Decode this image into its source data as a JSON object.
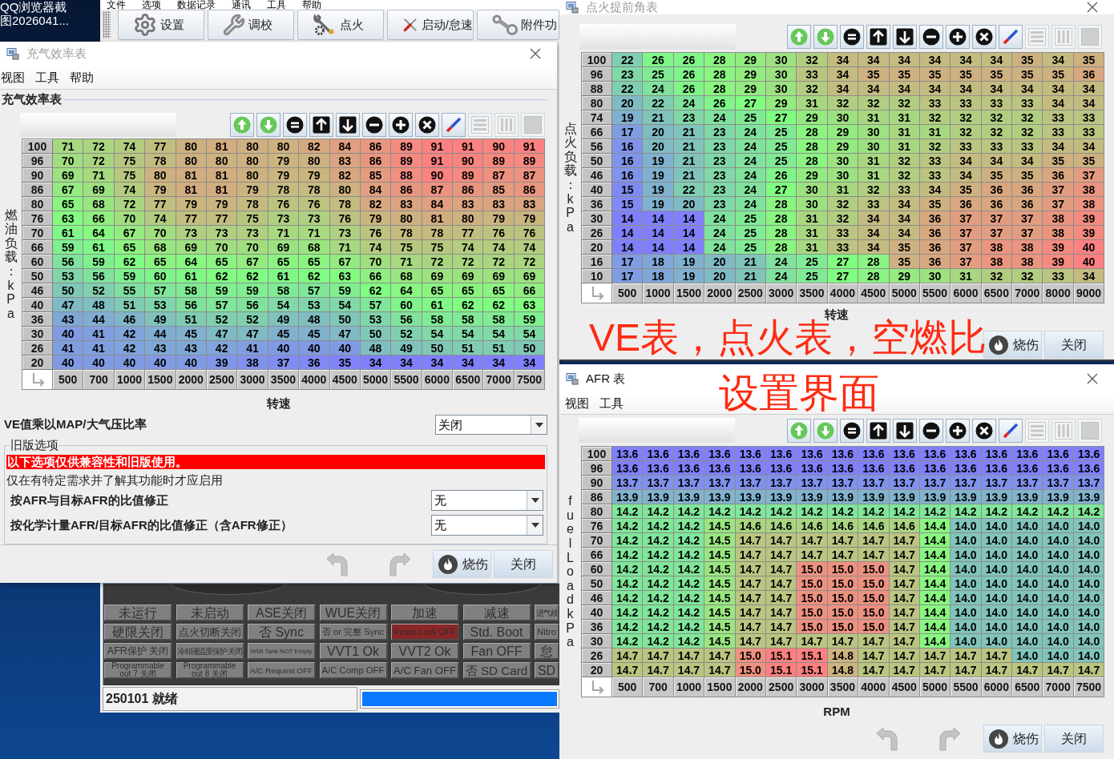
{
  "desktop": {
    "icon_label_lines": [
      "QQ浏览器截",
      "图2026041..."
    ]
  },
  "main_window": {
    "menu": [
      "文件",
      "选项",
      "数据记录",
      "通讯",
      "工具",
      "帮助"
    ],
    "toolbar": [
      "设置",
      "调校",
      "点火",
      "启动/怠速",
      "附件功"
    ],
    "indicators": [
      [
        {
          "label": "未运行",
          "color": "#808080"
        },
        {
          "label": "未启动",
          "color": "#808080"
        },
        {
          "label": "ASE关闭",
          "color": "#808080"
        },
        {
          "label": "WUE关闭",
          "color": "#808080"
        },
        {
          "label": "加速",
          "color": "#808080"
        },
        {
          "label": "减速",
          "color": "#808080"
        },
        {
          "label": "进气歧",
          "color": "#808080"
        }
      ],
      [
        {
          "label": "硬限关闭",
          "color": "#808080"
        },
        {
          "label": "点火切断关闭",
          "color": "#808080"
        },
        {
          "label": "否 Sync",
          "color": "#808080"
        },
        {
          "label": "否 or 完整 Sync",
          "color": "#808080"
        },
        {
          "label": "Reset Lock OFF",
          "color": "#8b2626"
        },
        {
          "label": "Std. Boot",
          "color": "#808080"
        },
        {
          "label": "Nitro",
          "color": "#808080"
        }
      ],
      [
        {
          "label": "AFR保护 关闭",
          "color": "#808080"
        },
        {
          "label": "冷却液温度保护 关闭",
          "color": "#808080"
        },
        {
          "label": "WMI Tank NOT Empty",
          "color": "#808080"
        },
        {
          "label": "VVT1 Ok",
          "color": "#808080"
        },
        {
          "label": "VVT2 Ok",
          "color": "#808080"
        },
        {
          "label": "Fan OFF",
          "color": "#808080"
        },
        {
          "label": "怠",
          "color": "#808080"
        }
      ],
      [
        {
          "label": "Programmable out 7 关闭",
          "color": "#808080"
        },
        {
          "label": "Programmable out 8 关闭",
          "color": "#808080"
        },
        {
          "label": "A/C Request OFF",
          "color": "#808080"
        },
        {
          "label": "A/C Comp OFF",
          "color": "#808080"
        },
        {
          "label": "A/C Fan OFF",
          "color": "#808080"
        },
        {
          "label": "否 SD Card",
          "color": "#808080"
        },
        {
          "label": "SD",
          "color": "#808080"
        }
      ]
    ],
    "status_bar": {
      "text": "250101 就绪",
      "progress": {
        "level": 1
      }
    }
  },
  "ve_window": {
    "title": "充气效率表",
    "active": false,
    "menu": [
      "视图",
      "工具",
      "帮助"
    ],
    "panel_title": "充气效率表",
    "tool_buttons": [
      {
        "disabled": false
      },
      {
        "disabled": false
      },
      {
        "disabled": false
      },
      {
        "disabled": false
      },
      {
        "disabled": false
      },
      {
        "disabled": false
      },
      {
        "disabled": false
      },
      {
        "disabled": false
      },
      {
        "disabled": false
      },
      {
        "disabled": true
      },
      {
        "disabled": true
      },
      {
        "disabled": true
      }
    ],
    "table": {
      "y_axis_label": "燃油负载： kPa",
      "x_axis_label": "转速",
      "y_bins": [
        "100",
        "96",
        "90",
        "86",
        "80",
        "76",
        "70",
        "66",
        "60",
        "50",
        "46",
        "40",
        "36",
        "30",
        "26",
        "20"
      ],
      "x_bins": [
        "500",
        "700",
        "1000",
        "1500",
        "2000",
        "2500",
        "3000",
        "3500",
        "4000",
        "4500",
        "5000",
        "5500",
        "6000",
        "6500",
        "7000",
        "7500"
      ],
      "rows": [
        [
          "71",
          "72",
          "74",
          "77",
          "80",
          "81",
          "80",
          "80",
          "82",
          "84",
          "86",
          "89",
          "91",
          "91",
          "90",
          "91"
        ],
        [
          "70",
          "72",
          "75",
          "78",
          "80",
          "80",
          "80",
          "79",
          "80",
          "83",
          "86",
          "89",
          "91",
          "90",
          "89",
          "89"
        ],
        [
          "69",
          "71",
          "75",
          "80",
          "81",
          "81",
          "80",
          "79",
          "79",
          "82",
          "85",
          "88",
          "90",
          "89",
          "87",
          "87"
        ],
        [
          "67",
          "69",
          "74",
          "79",
          "81",
          "81",
          "79",
          "78",
          "78",
          "80",
          "84",
          "86",
          "87",
          "86",
          "85",
          "86"
        ],
        [
          "65",
          "68",
          "72",
          "77",
          "79",
          "79",
          "78",
          "76",
          "76",
          "78",
          "82",
          "83",
          "84",
          "83",
          "83",
          "83"
        ],
        [
          "63",
          "66",
          "70",
          "74",
          "77",
          "77",
          "75",
          "73",
          "73",
          "76",
          "79",
          "80",
          "81",
          "80",
          "79",
          "79"
        ],
        [
          "61",
          "64",
          "67",
          "70",
          "73",
          "73",
          "73",
          "71",
          "71",
          "73",
          "76",
          "78",
          "78",
          "77",
          "76",
          "76"
        ],
        [
          "59",
          "61",
          "65",
          "68",
          "69",
          "70",
          "70",
          "69",
          "68",
          "71",
          "74",
          "75",
          "75",
          "74",
          "74",
          "74"
        ],
        [
          "56",
          "59",
          "62",
          "65",
          "64",
          "65",
          "67",
          "65",
          "65",
          "67",
          "70",
          "71",
          "72",
          "72",
          "72",
          "72"
        ],
        [
          "53",
          "56",
          "59",
          "60",
          "61",
          "62",
          "62",
          "61",
          "62",
          "63",
          "66",
          "68",
          "69",
          "69",
          "69",
          "69"
        ],
        [
          "50",
          "52",
          "55",
          "57",
          "58",
          "59",
          "59",
          "58",
          "57",
          "59",
          "62",
          "64",
          "65",
          "65",
          "65",
          "66"
        ],
        [
          "47",
          "48",
          "51",
          "53",
          "56",
          "57",
          "56",
          "54",
          "53",
          "54",
          "57",
          "60",
          "61",
          "62",
          "62",
          "63"
        ],
        [
          "43",
          "44",
          "46",
          "49",
          "51",
          "52",
          "52",
          "49",
          "48",
          "50",
          "53",
          "56",
          "58",
          "58",
          "58",
          "59"
        ],
        [
          "40",
          "41",
          "42",
          "44",
          "45",
          "47",
          "47",
          "45",
          "45",
          "47",
          "50",
          "52",
          "54",
          "54",
          "54",
          "54"
        ],
        [
          "41",
          "41",
          "42",
          "43",
          "43",
          "42",
          "41",
          "40",
          "40",
          "40",
          "48",
          "49",
          "50",
          "51",
          "51",
          "50"
        ],
        [
          "40",
          "40",
          "40",
          "40",
          "40",
          "39",
          "38",
          "37",
          "36",
          "35",
          "34",
          "34",
          "34",
          "34",
          "34",
          "34"
        ]
      ]
    },
    "option": {
      "label": "VE值乘以MAP/大气压比率",
      "value": "关闭"
    },
    "legacy_options": {
      "title": "旧版选项",
      "warning": "以下选项仅供兼容性和旧版使用。",
      "note": "仅在有特定需求并了解其功能时才应启用",
      "settings": [
        {
          "label": "按AFR与目标AFR的比值修正",
          "value": "无"
        },
        {
          "label": "按化学计量AFR/目标AFR的比值修正（含AFR修正）",
          "value": "无"
        }
      ]
    },
    "buttons": [
      {
        "label": "烧伤",
        "kind": "burn"
      },
      {
        "label": "关闭",
        "kind": "close"
      }
    ]
  },
  "ignition_window": {
    "title": "点火提前角表",
    "active": false,
    "tool_buttons": [
      {
        "disabled": false
      },
      {
        "disabled": false
      },
      {
        "disabled": false
      },
      {
        "disabled": false
      },
      {
        "disabled": false
      },
      {
        "disabled": false
      },
      {
        "disabled": false
      },
      {
        "disabled": false
      },
      {
        "disabled": false
      },
      {
        "disabled": true
      },
      {
        "disabled": true
      },
      {
        "disabled": true
      }
    ],
    "table": {
      "y_axis_label": "点火负载： kPa",
      "x_axis_label": "转速",
      "y_bins": [
        "100",
        "96",
        "88",
        "80",
        "74",
        "66",
        "56",
        "50",
        "46",
        "40",
        "36",
        "30",
        "26",
        "20",
        "16",
        "10"
      ],
      "x_bins": [
        "500",
        "1000",
        "1500",
        "2000",
        "2500",
        "3000",
        "3500",
        "4000",
        "4500",
        "5000",
        "5500",
        "6000",
        "6500",
        "7000",
        "8000",
        "9000"
      ],
      "rows": [
        [
          "22",
          "26",
          "26",
          "28",
          "29",
          "30",
          "32",
          "34",
          "34",
          "34",
          "34",
          "34",
          "34",
          "35",
          "34",
          "35"
        ],
        [
          "23",
          "25",
          "26",
          "28",
          "29",
          "30",
          "33",
          "34",
          "35",
          "35",
          "35",
          "35",
          "35",
          "35",
          "35",
          "36"
        ],
        [
          "22",
          "24",
          "26",
          "28",
          "29",
          "30",
          "32",
          "34",
          "34",
          "34",
          "34",
          "34",
          "34",
          "34",
          "34",
          "34"
        ],
        [
          "20",
          "22",
          "24",
          "26",
          "27",
          "29",
          "31",
          "32",
          "32",
          "32",
          "33",
          "33",
          "33",
          "33",
          "34",
          "34"
        ],
        [
          "19",
          "21",
          "23",
          "24",
          "25",
          "27",
          "29",
          "30",
          "31",
          "31",
          "32",
          "32",
          "32",
          "32",
          "33",
          "33"
        ],
        [
          "17",
          "20",
          "21",
          "23",
          "24",
          "25",
          "28",
          "29",
          "30",
          "31",
          "31",
          "32",
          "32",
          "32",
          "33",
          "33"
        ],
        [
          "16",
          "20",
          "21",
          "23",
          "24",
          "25",
          "28",
          "29",
          "30",
          "31",
          "32",
          "33",
          "33",
          "33",
          "34",
          "34"
        ],
        [
          "16",
          "19",
          "21",
          "23",
          "24",
          "25",
          "28",
          "30",
          "31",
          "32",
          "33",
          "34",
          "34",
          "34",
          "35",
          "35"
        ],
        [
          "16",
          "19",
          "21",
          "23",
          "24",
          "26",
          "29",
          "30",
          "31",
          "32",
          "33",
          "34",
          "35",
          "35",
          "36",
          "37"
        ],
        [
          "15",
          "19",
          "22",
          "23",
          "24",
          "27",
          "30",
          "31",
          "32",
          "33",
          "34",
          "35",
          "36",
          "36",
          "37",
          "38"
        ],
        [
          "15",
          "19",
          "20",
          "23",
          "24",
          "28",
          "30",
          "32",
          "33",
          "34",
          "35",
          "36",
          "36",
          "36",
          "37",
          "38"
        ],
        [
          "14",
          "14",
          "14",
          "24",
          "25",
          "28",
          "31",
          "32",
          "34",
          "34",
          "36",
          "37",
          "37",
          "37",
          "38",
          "39"
        ],
        [
          "14",
          "14",
          "14",
          "24",
          "25",
          "28",
          "31",
          "33",
          "34",
          "34",
          "36",
          "37",
          "37",
          "37",
          "38",
          "39"
        ],
        [
          "14",
          "14",
          "14",
          "24",
          "25",
          "28",
          "31",
          "33",
          "34",
          "35",
          "36",
          "37",
          "38",
          "38",
          "39",
          "40"
        ],
        [
          "17",
          "18",
          "19",
          "20",
          "21",
          "24",
          "25",
          "27",
          "28",
          "35",
          "36",
          "37",
          "38",
          "38",
          "39",
          "40"
        ],
        [
          "17",
          "18",
          "19",
          "20",
          "21",
          "24",
          "25",
          "27",
          "28",
          "29",
          "30",
          "31",
          "32",
          "32",
          "33",
          "34"
        ]
      ]
    },
    "annotation": "VE表，点火表，空燃比",
    "buttons": [
      {
        "label": "烧伤",
        "kind": "burn"
      },
      {
        "label": "关闭",
        "kind": "close"
      }
    ]
  },
  "afr_window": {
    "title": "AFR 表",
    "active": true,
    "annotation": "设置界面",
    "menu": [
      "视图",
      "工具"
    ],
    "tool_buttons": [
      {
        "disabled": false
      },
      {
        "disabled": false
      },
      {
        "disabled": false
      },
      {
        "disabled": false
      },
      {
        "disabled": false
      },
      {
        "disabled": false
      },
      {
        "disabled": false
      },
      {
        "disabled": false
      },
      {
        "disabled": false
      },
      {
        "disabled": true
      },
      {
        "disabled": true
      },
      {
        "disabled": true
      }
    ],
    "table": {
      "y_axis_label": "fuelLoad kPa",
      "x_axis_label": "RPM",
      "y_bins": [
        "100",
        "96",
        "90",
        "86",
        "80",
        "76",
        "70",
        "66",
        "60",
        "50",
        "46",
        "40",
        "36",
        "30",
        "26",
        "20"
      ],
      "x_bins": [
        "500",
        "700",
        "1000",
        "1500",
        "2000",
        "2500",
        "3000",
        "3500",
        "4000",
        "4500",
        "5000",
        "5500",
        "6000",
        "6500",
        "7000",
        "7500"
      ],
      "rows": [
        [
          "13.6",
          "13.6",
          "13.6",
          "13.6",
          "13.6",
          "13.6",
          "13.6",
          "13.6",
          "13.6",
          "13.6",
          "13.6",
          "13.6",
          "13.6",
          "13.6",
          "13.6",
          "13.6"
        ],
        [
          "13.6",
          "13.6",
          "13.6",
          "13.6",
          "13.6",
          "13.6",
          "13.6",
          "13.6",
          "13.6",
          "13.6",
          "13.6",
          "13.6",
          "13.6",
          "13.6",
          "13.6",
          "13.6"
        ],
        [
          "13.7",
          "13.7",
          "13.7",
          "13.7",
          "13.7",
          "13.7",
          "13.7",
          "13.7",
          "13.7",
          "13.7",
          "13.7",
          "13.7",
          "13.7",
          "13.7",
          "13.7",
          "13.7"
        ],
        [
          "13.9",
          "13.9",
          "13.9",
          "13.9",
          "13.9",
          "13.9",
          "13.9",
          "13.9",
          "13.9",
          "13.9",
          "13.9",
          "13.9",
          "13.9",
          "13.9",
          "13.9",
          "13.9"
        ],
        [
          "14.2",
          "14.2",
          "14.2",
          "14.2",
          "14.2",
          "14.2",
          "14.2",
          "14.2",
          "14.2",
          "14.2",
          "14.2",
          "14.2",
          "14.2",
          "14.2",
          "14.2",
          "14.2"
        ],
        [
          "14.2",
          "14.2",
          "14.2",
          "14.5",
          "14.6",
          "14.6",
          "14.6",
          "14.6",
          "14.6",
          "14.6",
          "14.4",
          "14.0",
          "14.0",
          "14.0",
          "14.0",
          "14.0"
        ],
        [
          "14.2",
          "14.2",
          "14.2",
          "14.5",
          "14.7",
          "14.7",
          "14.7",
          "14.7",
          "14.7",
          "14.7",
          "14.4",
          "14.0",
          "14.0",
          "14.0",
          "14.0",
          "14.0"
        ],
        [
          "14.2",
          "14.2",
          "14.2",
          "14.5",
          "14.7",
          "14.7",
          "14.7",
          "14.7",
          "14.7",
          "14.7",
          "14.4",
          "14.0",
          "14.0",
          "14.0",
          "14.0",
          "14.0"
        ],
        [
          "14.2",
          "14.2",
          "14.2",
          "14.5",
          "14.7",
          "14.7",
          "15.0",
          "15.0",
          "15.0",
          "14.7",
          "14.4",
          "14.0",
          "14.0",
          "14.0",
          "14.0",
          "14.0"
        ],
        [
          "14.2",
          "14.2",
          "14.2",
          "14.5",
          "14.7",
          "14.7",
          "15.0",
          "15.0",
          "15.0",
          "14.7",
          "14.4",
          "14.0",
          "14.0",
          "14.0",
          "14.0",
          "14.0"
        ],
        [
          "14.2",
          "14.2",
          "14.2",
          "14.5",
          "14.7",
          "14.7",
          "15.0",
          "15.0",
          "15.0",
          "14.7",
          "14.4",
          "14.0",
          "14.0",
          "14.0",
          "14.0",
          "14.0"
        ],
        [
          "14.2",
          "14.2",
          "14.2",
          "14.5",
          "14.7",
          "14.7",
          "15.0",
          "15.0",
          "15.0",
          "14.7",
          "14.4",
          "14.0",
          "14.0",
          "14.0",
          "14.0",
          "14.0"
        ],
        [
          "14.2",
          "14.2",
          "14.2",
          "14.5",
          "14.7",
          "14.7",
          "15.0",
          "15.0",
          "15.0",
          "14.7",
          "14.4",
          "14.0",
          "14.0",
          "14.0",
          "14.0",
          "14.0"
        ],
        [
          "14.2",
          "14.2",
          "14.2",
          "14.5",
          "14.7",
          "14.7",
          "14.7",
          "14.7",
          "14.7",
          "14.7",
          "14.4",
          "14.0",
          "14.0",
          "14.0",
          "14.0",
          "14.0"
        ],
        [
          "14.7",
          "14.7",
          "14.7",
          "14.7",
          "15.0",
          "15.1",
          "15.1",
          "14.8",
          "14.7",
          "14.7",
          "14.7",
          "14.7",
          "14.7",
          "14.0",
          "14.0",
          "14.0"
        ],
        [
          "14.7",
          "14.7",
          "14.7",
          "14.7",
          "15.0",
          "15.1",
          "15.1",
          "14.8",
          "14.7",
          "14.7",
          "14.7",
          "14.7",
          "14.7",
          "14.7",
          "14.7",
          "14.7"
        ]
      ]
    },
    "buttons": [
      {
        "label": "烧伤",
        "kind": "burn"
      },
      {
        "label": "关闭",
        "kind": "close"
      }
    ]
  }
}
